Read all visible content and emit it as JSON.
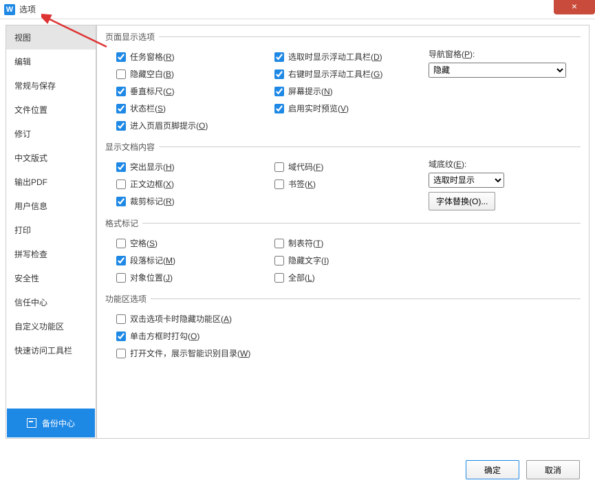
{
  "title": "选项",
  "close_icon": "×",
  "sidebar": {
    "items": [
      {
        "label": "视图"
      },
      {
        "label": "编辑"
      },
      {
        "label": "常规与保存"
      },
      {
        "label": "文件位置"
      },
      {
        "label": "修订"
      },
      {
        "label": "中文版式"
      },
      {
        "label": "输出PDF"
      },
      {
        "label": "用户信息"
      },
      {
        "label": "打印"
      },
      {
        "label": "拼写检查"
      },
      {
        "label": "安全性"
      },
      {
        "label": "信任中心"
      },
      {
        "label": "自定义功能区"
      },
      {
        "label": "快速访问工具栏"
      }
    ],
    "backup_label": "备份中心"
  },
  "groups": {
    "page_display": {
      "legend": "页面显示选项",
      "left": [
        {
          "label": "任务窗格(",
          "key": "R",
          "checked": true
        },
        {
          "label": "隐藏空白(",
          "key": "B",
          "checked": false
        },
        {
          "label": "垂直标尺(",
          "key": "C",
          "checked": true
        },
        {
          "label": "状态栏(",
          "key": "S",
          "checked": true
        },
        {
          "label": "进入页眉页脚提示(",
          "key": "O",
          "checked": true
        }
      ],
      "mid": [
        {
          "label": "选取时显示浮动工具栏(",
          "key": "D",
          "checked": true
        },
        {
          "label": "右键时显示浮动工具栏(",
          "key": "G",
          "checked": true
        },
        {
          "label": "屏幕提示(",
          "key": "N",
          "checked": true
        },
        {
          "label": "启用实时预览(",
          "key": "V",
          "checked": true
        }
      ],
      "right": {
        "label": "导航窗格(",
        "key": "P",
        "select": "隐藏"
      }
    },
    "doc_content": {
      "legend": "显示文档内容",
      "left": [
        {
          "label": "突出显示(",
          "key": "H",
          "checked": true
        },
        {
          "label": "正文边框(",
          "key": "X",
          "checked": false
        },
        {
          "label": "裁剪标记(",
          "key": "R",
          "checked": true
        }
      ],
      "mid": [
        {
          "label": "域代码(",
          "key": "F",
          "checked": false
        },
        {
          "label": "书签(",
          "key": "K",
          "checked": false
        }
      ],
      "right": {
        "label": "域底纹(",
        "key": "E",
        "select": "选取时显示",
        "button": "字体替换(O)..."
      }
    },
    "format_marks": {
      "legend": "格式标记",
      "left": [
        {
          "label": "空格(",
          "key": "S",
          "checked": false
        },
        {
          "label": "段落标记(",
          "key": "M",
          "checked": true
        },
        {
          "label": "对象位置(",
          "key": "J",
          "checked": false
        }
      ],
      "mid": [
        {
          "label": "制表符(",
          "key": "T",
          "checked": false
        },
        {
          "label": "隐藏文字(",
          "key": "I",
          "checked": false
        },
        {
          "label": "全部(",
          "key": "L",
          "checked": false
        }
      ]
    },
    "ribbon": {
      "legend": "功能区选项",
      "items": [
        {
          "label": "双击选项卡时隐藏功能区(",
          "key": "A",
          "checked": false
        },
        {
          "label": "单击方框时打勾(",
          "key": "O",
          "checked": true
        },
        {
          "label": "打开文件，展示智能识别目录(",
          "key": "W",
          "checked": false
        }
      ]
    }
  },
  "footer": {
    "ok": "确定",
    "cancel": "取消"
  }
}
